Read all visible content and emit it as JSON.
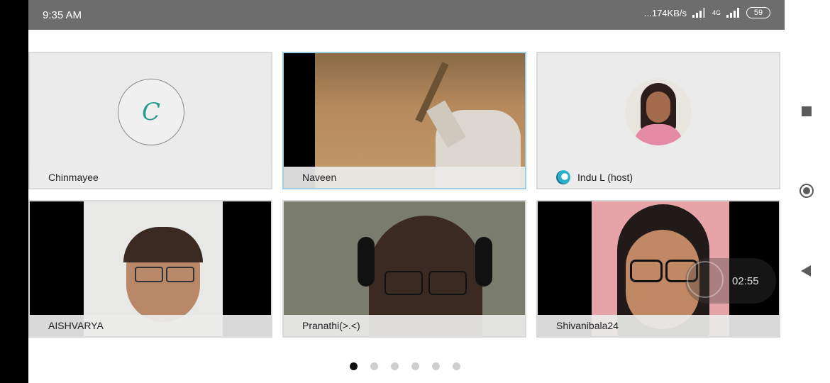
{
  "status_bar": {
    "time": "9:35 AM",
    "network_speed": "...174KB/s",
    "network_type": "4G",
    "battery": "59"
  },
  "participants": [
    {
      "name": "Chinmayee",
      "avatar_letter": "C",
      "video": false
    },
    {
      "name": "Naveen",
      "video": true,
      "active_speaker": true
    },
    {
      "name": "Indu L (host)",
      "video": false,
      "host": true
    },
    {
      "name": "AISHVARYA",
      "video": true
    },
    {
      "name": "Pranathi(>.<)",
      "video": true
    },
    {
      "name": "Shivanibala24",
      "video": true
    }
  ],
  "timer": {
    "value": "02:55"
  },
  "pagination": {
    "total": 6,
    "current": 1
  },
  "nav": {
    "square_icon": "square-icon",
    "home_icon": "circle-home-icon",
    "back_icon": "triangle-back-icon"
  }
}
